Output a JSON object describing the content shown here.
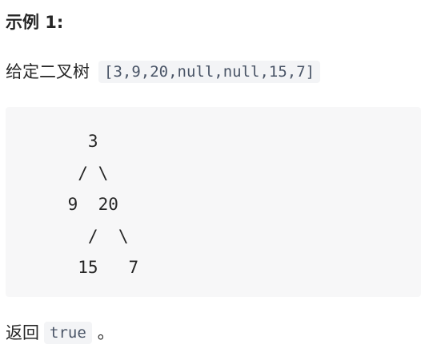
{
  "example": {
    "title": "示例 1:",
    "given_label": "给定二叉树",
    "given_code": "[3,9,20,null,null,15,7]",
    "tree_diagram": "   3\n  / \\\n 9  20\n   /  \\\n  15   7",
    "return_label": "返回",
    "return_code": "true",
    "return_suffix": "。"
  }
}
